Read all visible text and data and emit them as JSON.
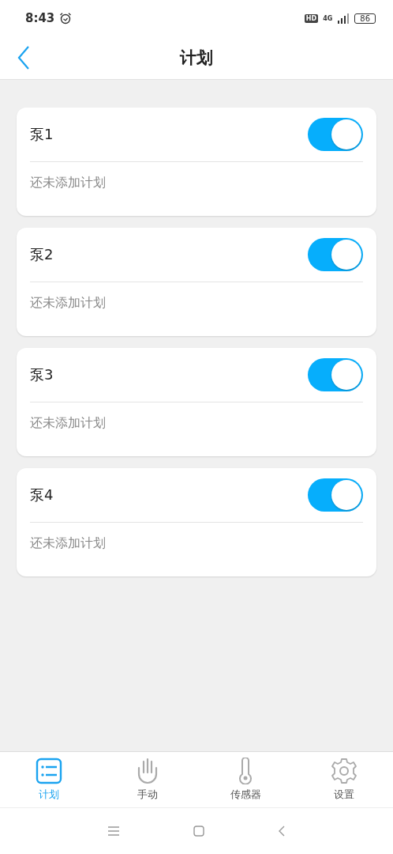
{
  "status_bar": {
    "time": "8:43",
    "hd": "HD",
    "network": "4G",
    "battery": "86"
  },
  "header": {
    "title": "计划"
  },
  "pumps": [
    {
      "name": "泵1",
      "on": true,
      "plan": "还未添加计划"
    },
    {
      "name": "泵2",
      "on": true,
      "plan": "还未添加计划"
    },
    {
      "name": "泵3",
      "on": true,
      "plan": "还未添加计划"
    },
    {
      "name": "泵4",
      "on": true,
      "plan": "还未添加计划"
    }
  ],
  "tabs": [
    {
      "kind": "list",
      "label": "计划",
      "selected": true
    },
    {
      "kind": "hand",
      "label": "手动",
      "selected": false
    },
    {
      "kind": "thermometer",
      "label": "传感器",
      "selected": false
    },
    {
      "kind": "gear",
      "label": "设置",
      "selected": false
    }
  ]
}
